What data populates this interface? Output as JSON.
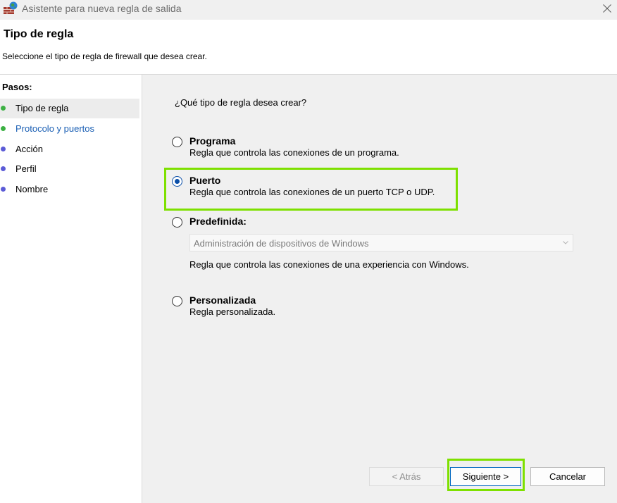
{
  "window": {
    "title": "Asistente para nueva regla de salida",
    "icon": "firewall-brick-globe-icon"
  },
  "header": {
    "title": "Tipo de regla",
    "subtitle": "Seleccione el tipo de regla de firewall que desea crear."
  },
  "steps": {
    "title": "Pasos:",
    "items": [
      {
        "label": "Tipo de regla",
        "state": "current",
        "dot_color": "#3cb043"
      },
      {
        "label": "Protocolo y puertos",
        "state": "link",
        "dot_color": "#3cb043"
      },
      {
        "label": "Acción",
        "state": "pending",
        "dot_color": "#5b5bd6"
      },
      {
        "label": "Perfil",
        "state": "pending",
        "dot_color": "#5b5bd6"
      },
      {
        "label": "Nombre",
        "state": "pending",
        "dot_color": "#5b5bd6"
      }
    ]
  },
  "main": {
    "question": "¿Qué tipo de regla desea crear?",
    "options": [
      {
        "label": "Programa",
        "description": "Regla que controla las conexiones de un programa.",
        "checked": false
      },
      {
        "label": "Puerto",
        "description": "Regla que controla las conexiones de un puerto TCP o UDP.",
        "checked": true
      },
      {
        "label": "Predefinida:",
        "description": "Regla que controla las conexiones de una experiencia con Windows.",
        "checked": false
      },
      {
        "label": "Personalizada",
        "description": "Regla personalizada.",
        "checked": false
      }
    ],
    "predefined_select": {
      "value": "Administración de dispositivos de Windows",
      "disabled": true
    }
  },
  "buttons": {
    "back": "< Atrás",
    "next": "Siguiente >",
    "cancel": "Cancelar"
  },
  "colors": {
    "highlight": "#7ee000",
    "radio_selected": "#0a4ea8",
    "link": "#1a5fb4"
  }
}
